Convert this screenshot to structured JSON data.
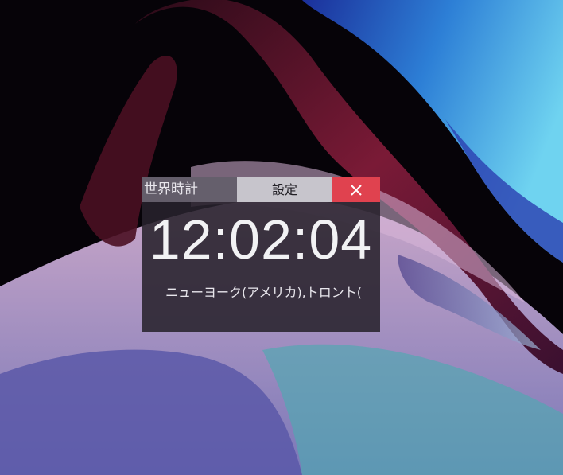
{
  "widget": {
    "title": "世界時計",
    "settings_label": "設定",
    "close_icon": "close-icon",
    "time": "12:02:04",
    "location": "ニューヨーク(アメリカ),トロント("
  },
  "colors": {
    "close_button": "#e0424f",
    "settings_button": "#c7c5cc",
    "widget_background": "#28222c"
  }
}
